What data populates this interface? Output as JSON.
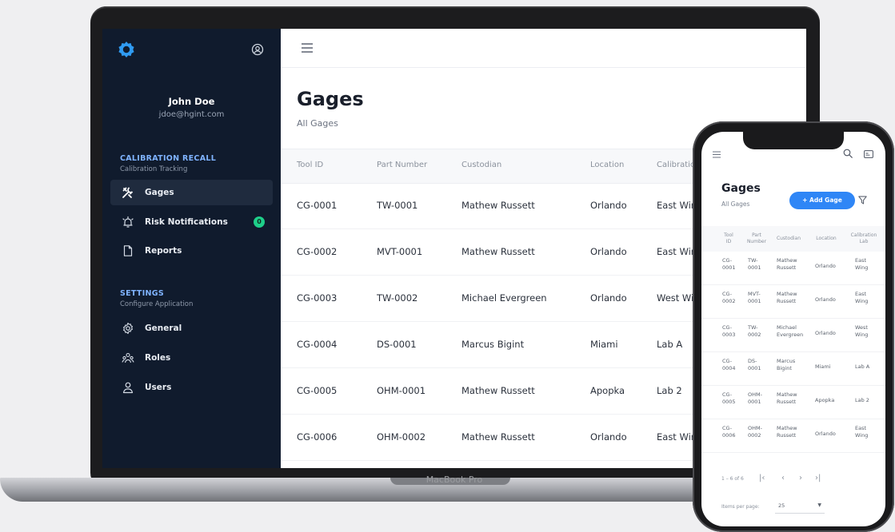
{
  "laptop": {
    "model_label": "MacBook Pro",
    "sidebar": {
      "user": {
        "name": "John Doe",
        "email": "jdoe@hgint.com"
      },
      "sections": [
        {
          "title": "CALIBRATION RECALL",
          "subtitle": "Calibration Tracking",
          "items": [
            {
              "label": "Gages",
              "icon": "tools-icon",
              "active": true
            },
            {
              "label": "Risk Notifications",
              "icon": "alarm-icon",
              "badge": "0"
            },
            {
              "label": "Reports",
              "icon": "file-icon"
            }
          ]
        },
        {
          "title": "SETTINGS",
          "subtitle": "Configure Application",
          "items": [
            {
              "label": "General",
              "icon": "gear-icon"
            },
            {
              "label": "Roles",
              "icon": "group-icon"
            },
            {
              "label": "Users",
              "icon": "user-icon"
            }
          ]
        }
      ]
    },
    "main": {
      "title": "Gages",
      "subtitle": "All Gages",
      "columns": [
        "Tool ID",
        "Part Number",
        "Custodian",
        "Location",
        "Calibration"
      ],
      "rows": [
        [
          "CG-0001",
          "TW-0001",
          "Mathew Russett",
          "Orlando",
          "East Wing"
        ],
        [
          "CG-0002",
          "MVT-0001",
          "Mathew Russett",
          "Orlando",
          "East Wing"
        ],
        [
          "CG-0003",
          "TW-0002",
          "Michael Evergreen",
          "Orlando",
          "West Wing"
        ],
        [
          "CG-0004",
          "DS-0001",
          "Marcus Bigint",
          "Miami",
          "Lab A"
        ],
        [
          "CG-0005",
          "OHM-0001",
          "Mathew Russett",
          "Apopka",
          "Lab 2"
        ],
        [
          "CG-0006",
          "OHM-0002",
          "Mathew Russett",
          "Orlando",
          "East Wing"
        ]
      ]
    }
  },
  "phone": {
    "title": "Gages",
    "subtitle": "All Gages",
    "add_button": "+ Add Gage",
    "columns": [
      [
        "Tool",
        "ID"
      ],
      [
        "Part",
        "Number"
      ],
      [
        "Custodian"
      ],
      [
        "Location"
      ],
      [
        "Calibration",
        "Lab"
      ]
    ],
    "rows": [
      [
        [
          "CG-",
          "0001"
        ],
        [
          "TW-",
          "0001"
        ],
        [
          "Mathew",
          "Russett"
        ],
        [
          "Orlando"
        ],
        [
          "East",
          "Wing"
        ]
      ],
      [
        [
          "CG-",
          "0002"
        ],
        [
          "MVT-",
          "0001"
        ],
        [
          "Mathew",
          "Russett"
        ],
        [
          "Orlando"
        ],
        [
          "East",
          "Wing"
        ]
      ],
      [
        [
          "CG-",
          "0003"
        ],
        [
          "TW-",
          "0002"
        ],
        [
          "Michael",
          "Evergreen"
        ],
        [
          "Orlando"
        ],
        [
          "West",
          "Wing"
        ]
      ],
      [
        [
          "CG-",
          "0004"
        ],
        [
          "DS-",
          "0001"
        ],
        [
          "Marcus",
          "Bigint"
        ],
        [
          "Miami"
        ],
        [
          "Lab A"
        ]
      ],
      [
        [
          "CG-",
          "0005"
        ],
        [
          "OHM-",
          "0001"
        ],
        [
          "Mathew",
          "Russett"
        ],
        [
          "Apopka"
        ],
        [
          "Lab 2"
        ]
      ],
      [
        [
          "CG-",
          "0006"
        ],
        [
          "OHM-",
          "0002"
        ],
        [
          "Mathew",
          "Russett"
        ],
        [
          "Orlando"
        ],
        [
          "East",
          "Wing"
        ]
      ]
    ],
    "pagination": {
      "range": "1 – 6 of 6",
      "items_per_page_label": "Items per page:",
      "items_per_page_value": "25"
    }
  },
  "colors": {
    "sidebar_bg": "#101b2d",
    "section_title": "#7fb3ff",
    "badge": "#1ecf8a",
    "primary_button": "#2f86f6"
  }
}
